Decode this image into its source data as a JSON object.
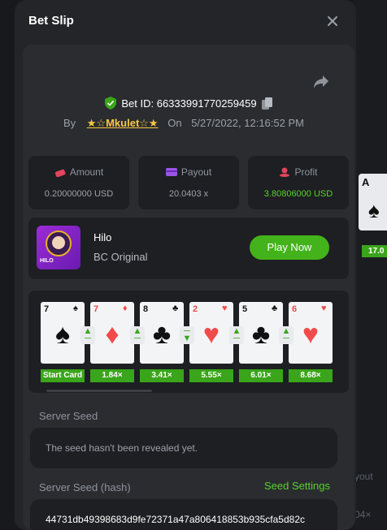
{
  "modal": {
    "title": "Bet Slip",
    "close_icon": "close-icon"
  },
  "bet": {
    "id_label": "Bet ID: 66333991770259459",
    "by_label": "By",
    "user": "★☆Mkulet☆★",
    "on_label": "On",
    "datetime": "5/27/2022, 12:16:52 PM"
  },
  "stats": {
    "amount": {
      "label": "Amount",
      "value": "0.20000000 USD",
      "icon": "coins-icon"
    },
    "payout": {
      "label": "Payout",
      "value": "20.0403 x",
      "icon": "wallet-icon"
    },
    "profit": {
      "label": "Profit",
      "value": "3.80806000 USD",
      "icon": "coin-stack-icon"
    }
  },
  "game": {
    "name": "Hilo",
    "sub": "BC Original",
    "thumb_label": "HILO",
    "play_label": "Play Now"
  },
  "cards": [
    {
      "rank": "7",
      "suit": "♠",
      "color": "black",
      "mult": "Start Card"
    },
    {
      "rank": "7",
      "suit": "♦",
      "color": "red",
      "mult": "1.84×",
      "arrow": "up"
    },
    {
      "rank": "8",
      "suit": "♣",
      "color": "black",
      "mult": "3.41×",
      "arrow": "up"
    },
    {
      "rank": "2",
      "suit": "♥",
      "color": "red",
      "mult": "5.55×",
      "arrow": "down"
    },
    {
      "rank": "5",
      "suit": "♣",
      "color": "black",
      "mult": "6.01×",
      "arrow": "up"
    },
    {
      "rank": "6",
      "suit": "♥",
      "color": "red",
      "mult": "8.68×",
      "arrow": "up"
    }
  ],
  "seeds": {
    "server_seed_label": "Server Seed",
    "server_seed_value": "The seed hasn't been revealed yet.",
    "hash_label": "Server Seed (hash)",
    "settings_label": "Seed Settings",
    "hash_value": "44731db49398683d9fe72371a47a806418853b935cfa5d82c"
  },
  "background": {
    "card_rank": "A",
    "card_suit": "♠",
    "mult": "17.0",
    "text1": "yout",
    "text2": "04×"
  },
  "colors": {
    "accent": "#44b21b",
    "profit": "#5bd02e",
    "user": "#f6c944"
  }
}
